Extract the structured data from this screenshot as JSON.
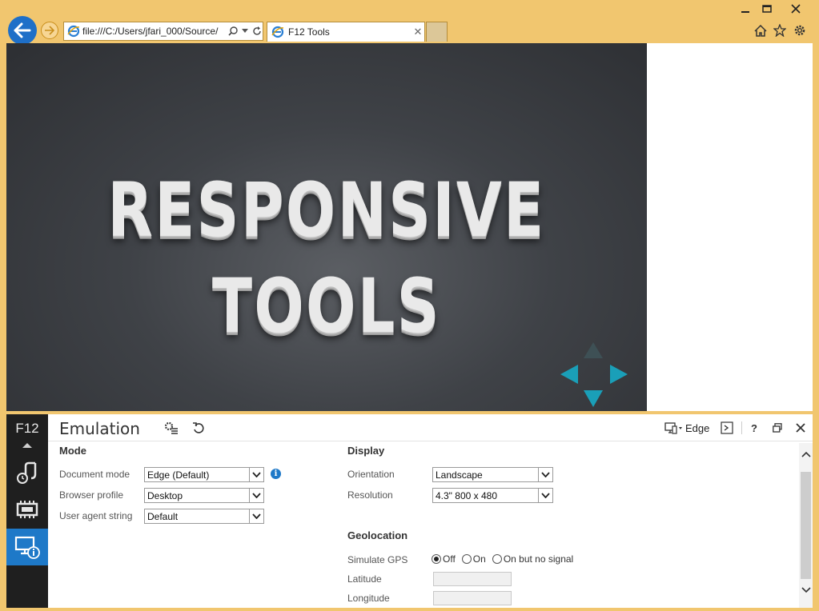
{
  "browser": {
    "address_url": "file:///C:/Users/jfari_000/Source/",
    "tab_title": "F12 Tools"
  },
  "colors": {
    "frame": "#f1c66f",
    "accent": "#1e79c8",
    "slide_arrow": "#1a9fb8"
  },
  "slide": {
    "title": "RESPONSIVE TOOLS"
  },
  "devtools": {
    "f12_label": "F12",
    "panel_title": "Emulation",
    "browser_target": "Edge",
    "help_label": "?",
    "mode": {
      "heading": "Mode",
      "document_mode_label": "Document mode",
      "document_mode_value": "Edge (Default)",
      "browser_profile_label": "Browser profile",
      "browser_profile_value": "Desktop",
      "user_agent_label": "User agent string",
      "user_agent_value": "Default"
    },
    "display": {
      "heading": "Display",
      "orientation_label": "Orientation",
      "orientation_value": "Landscape",
      "resolution_label": "Resolution",
      "resolution_value": "4.3\" 800 x 480"
    },
    "geolocation": {
      "heading": "Geolocation",
      "simulate_gps_label": "Simulate GPS",
      "gps_options": [
        "Off",
        "On",
        "On but no signal"
      ],
      "gps_selected": "Off",
      "latitude_label": "Latitude",
      "latitude_value": "",
      "longitude_label": "Longitude",
      "longitude_value": ""
    }
  }
}
